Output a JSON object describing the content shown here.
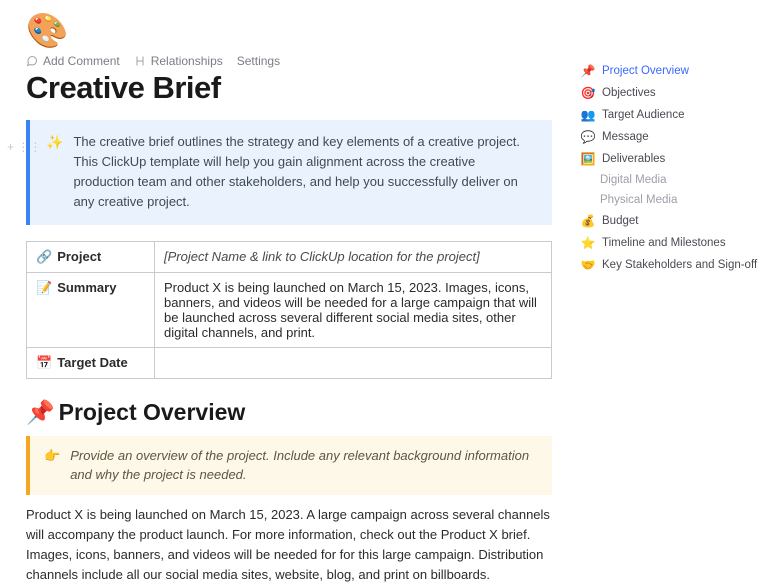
{
  "header": {
    "icon": "🎨"
  },
  "toolbar": {
    "add_comment": "Add Comment",
    "relationships": "Relationships",
    "settings": "Settings"
  },
  "title": "Creative Brief",
  "callout": {
    "icon": "✨",
    "text": "The creative brief outlines the strategy and key elements of a creative project. This ClickUp template will help you gain alignment across the creative production team and other stakeholders, and help you successfully deliver on any creative project."
  },
  "table": {
    "rows": [
      {
        "icon": "🔗",
        "label": "Project",
        "value": "[Project Name & link to ClickUp location for the project]",
        "placeholder": true
      },
      {
        "icon": "📝",
        "label": "Summary",
        "value": "Product X is being launched on March 15, 2023. Images, icons, banners, and videos will be needed for a large campaign that will be launched across several different social media sites, other digital channels, and print.",
        "placeholder": false
      },
      {
        "icon": "📅",
        "label": "Target Date",
        "value": "",
        "placeholder": false
      }
    ]
  },
  "overview": {
    "heading_icon": "📌",
    "heading": "Project Overview",
    "note_icon": "👉",
    "note": "Provide an overview of the project. Include any relevant background information and why the project is needed.",
    "body": "Product X is being launched on March 15, 2023. A large campaign across several channels will accompany the product launch. For more information, check out the Product X brief. Images, icons, banners, and videos will be needed for for this large campaign. Distribution channels include all our social media sites, website, blog, and print on billboards."
  },
  "sidebar": {
    "items": [
      {
        "icon": "📌",
        "label": "Project Overview",
        "active": true
      },
      {
        "icon": "🎯",
        "label": "Objectives"
      },
      {
        "icon": "👥",
        "label": "Target Audience"
      },
      {
        "icon": "💬",
        "label": "Message"
      },
      {
        "icon": "🖼️",
        "label": "Deliverables"
      },
      {
        "icon": "",
        "label": "Digital Media",
        "sub": true
      },
      {
        "icon": "",
        "label": "Physical Media",
        "sub": true
      },
      {
        "icon": "💰",
        "label": "Budget"
      },
      {
        "icon": "⭐",
        "label": "Timeline and Milestones"
      },
      {
        "icon": "🤝",
        "label": "Key Stakeholders and Sign-off"
      }
    ]
  }
}
